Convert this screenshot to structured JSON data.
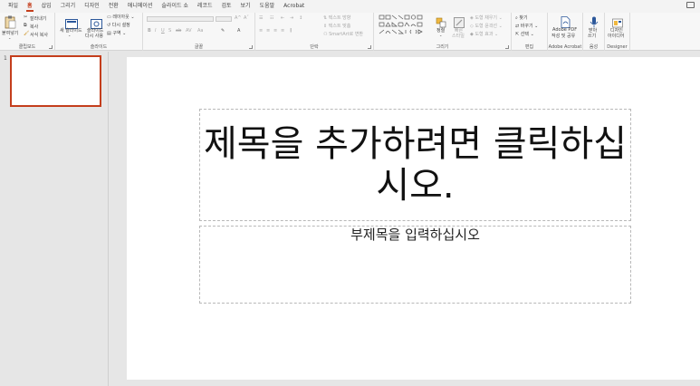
{
  "tabs": [
    "파일",
    "홈",
    "삽입",
    "그리기",
    "디자인",
    "전환",
    "애니메이션",
    "슬라이드 쇼",
    "레코드",
    "검토",
    "보기",
    "도움말",
    "Acrobat"
  ],
  "active_tab_index": 1,
  "ribbon": {
    "clipboard": {
      "label": "클립보드",
      "paste": "붙여넣기",
      "cut": "잘라내기",
      "copy": "복사",
      "format_painter": "서식 복사"
    },
    "slides": {
      "label": "슬라이드",
      "new_slide_line1": "새",
      "new_slide_line2": "슬라이드",
      "reuse_line1": "슬라이드",
      "reuse_line2": "다시 사용",
      "layout": "레이아웃",
      "reset": "다시 설정",
      "section": "구역"
    },
    "font": {
      "label": "글꼴"
    },
    "paragraph": {
      "label": "단락",
      "text_direction": "텍스트 방향",
      "align_text": "텍스트 맞춤",
      "smartart": "SmartArt로 변환"
    },
    "drawing": {
      "label": "그리기",
      "arrange": "정렬",
      "quick_styles_line1": "빠른",
      "quick_styles_line2": "스타일",
      "shape_fill": "도형 채우기",
      "shape_outline": "도형 윤곽선",
      "shape_effects": "도형 효과"
    },
    "editing": {
      "label": "편집",
      "find": "찾기",
      "replace": "바꾸기",
      "select": "선택"
    },
    "acrobat": {
      "label": "Adobe Acrobat",
      "btn_line1": "Adobe PDF",
      "btn_line2": "작성 및 공유"
    },
    "voice": {
      "label": "음성",
      "dictate_line1": "받아",
      "dictate_line2": "쓰기"
    },
    "designer": {
      "label": "Designer",
      "btn_line1": "디자인",
      "btn_line2": "아이디어"
    }
  },
  "thumbnails": [
    {
      "number": "1"
    }
  ],
  "slide": {
    "title_placeholder": "제목을 추가하려면 클릭하십시오.",
    "subtitle_placeholder": "부제목을 입력하십시오"
  },
  "colors": {
    "accent": "#c43e1c",
    "ribbon_bg": "#f7f7f7",
    "workspace_bg": "#e6e6e6"
  }
}
